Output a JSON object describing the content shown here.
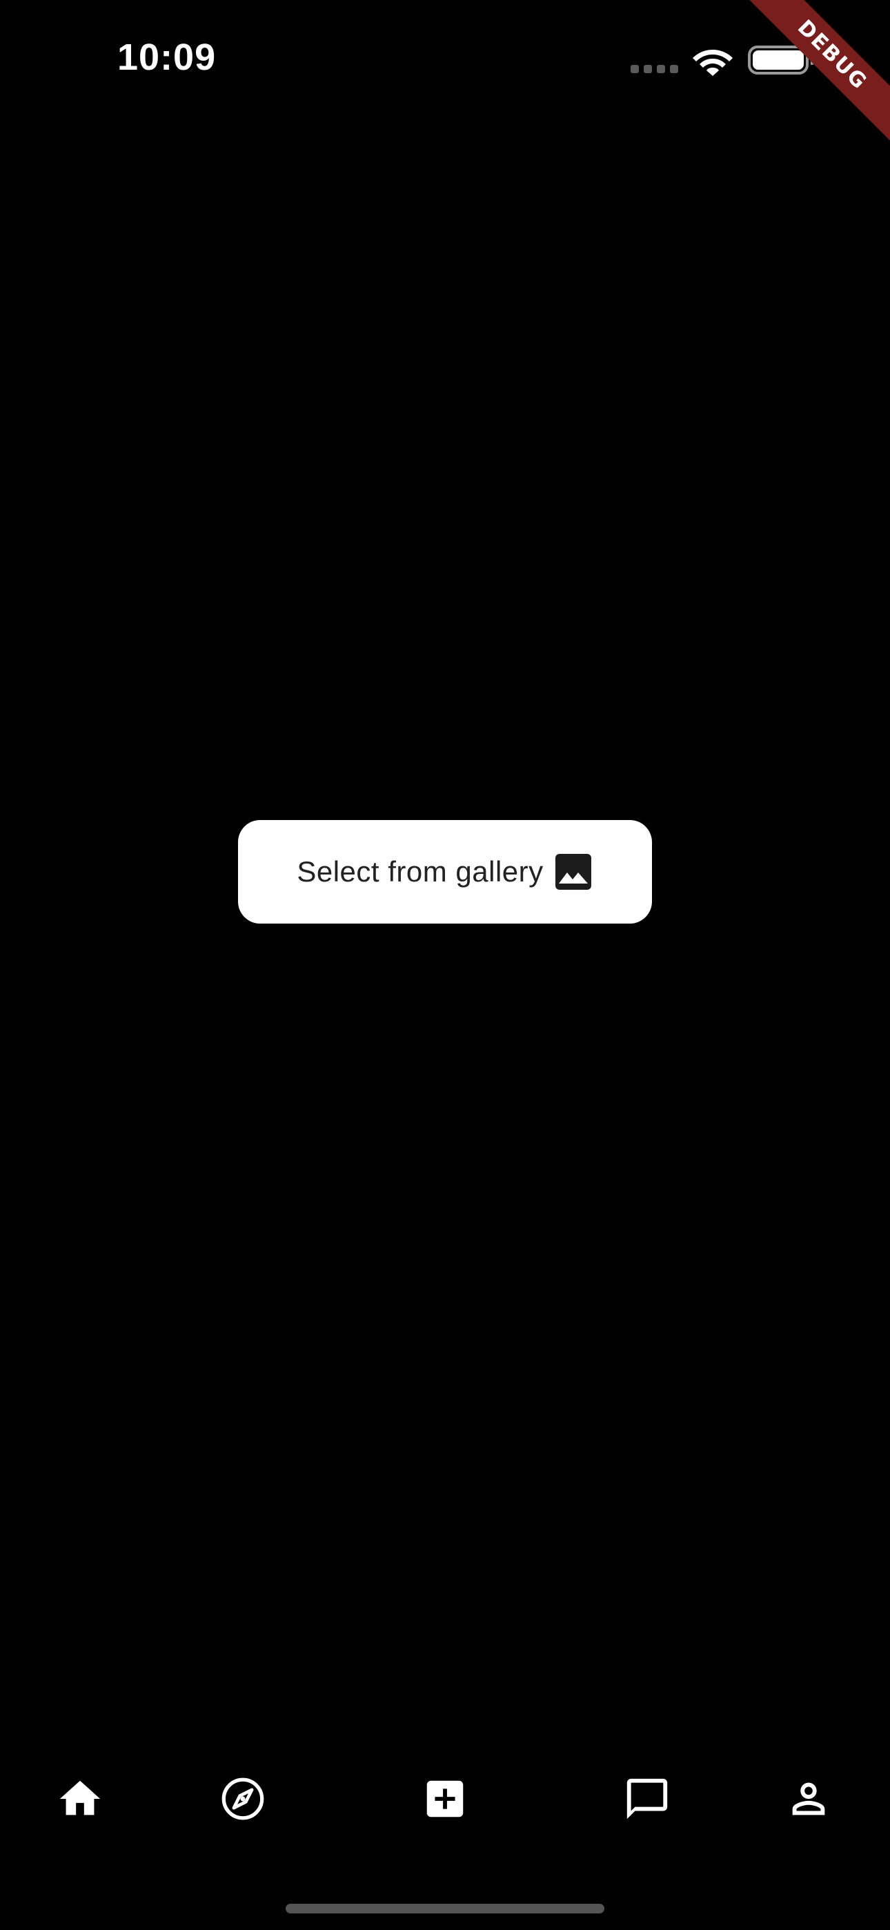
{
  "status_bar": {
    "time": "10:09"
  },
  "debug_banner": "DEBUG",
  "main": {
    "gallery_button_label": "Select from gallery",
    "gallery_button_icon": "image-icon"
  },
  "bottom_nav": {
    "items": [
      {
        "icon": "home-icon"
      },
      {
        "icon": "compass-icon"
      },
      {
        "icon": "add-box-icon"
      },
      {
        "icon": "chat-icon"
      },
      {
        "icon": "person-icon"
      }
    ]
  },
  "colors": {
    "background": "#000000",
    "button_background": "#ffffff",
    "debug_ribbon": "#7a1d1d"
  }
}
